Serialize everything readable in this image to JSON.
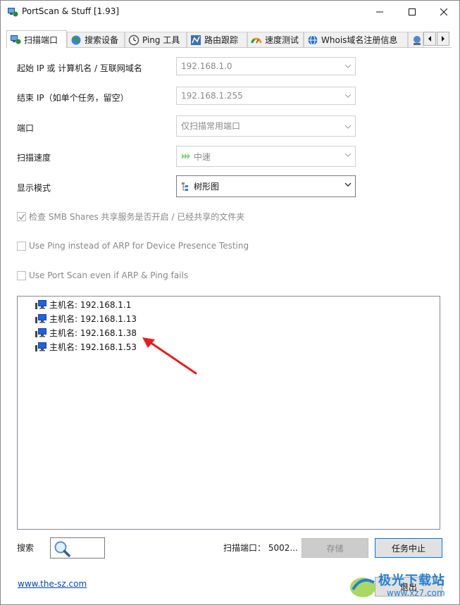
{
  "window": {
    "title": "PortScan & Stuff [1.93]"
  },
  "tabs": [
    {
      "label": "扫描端口",
      "icon": "scan-icon",
      "active": true
    },
    {
      "label": "搜索设备",
      "icon": "globe-icon",
      "active": false
    },
    {
      "label": "Ping 工具",
      "icon": "ping-clock-icon",
      "active": false
    },
    {
      "label": "路由跟踪",
      "icon": "route-icon",
      "active": false
    },
    {
      "label": "速度测试",
      "icon": "speedometer-icon",
      "active": false
    },
    {
      "label": "Whois域名注册信息",
      "icon": "whois-globe-icon",
      "active": false
    }
  ],
  "form": {
    "start_ip_label": "起始 IP 或 计算机名 / 互联网域名",
    "start_ip_value": "192.168.1.0",
    "end_ip_label": "结束 IP（如单个任务，留空）",
    "end_ip_value": "192.168.1.255",
    "port_label": "端口",
    "port_value": "仅扫描常用端口",
    "speed_label": "扫描速度",
    "speed_value": "中速",
    "display_label": "显示模式",
    "display_value": "树形图"
  },
  "checkboxes": {
    "smb": {
      "label": "检查 SMB Shares 共享服务是否开启 / 已经共享的文件夹",
      "checked": true
    },
    "ping": {
      "label": "Use Ping instead of ARP for Device Presence Testing",
      "checked": false
    },
    "portscan": {
      "label": "Use Port Scan even if ARP & Ping fails",
      "checked": false
    }
  },
  "results": [
    {
      "text": "主机名: 192.168.1.1"
    },
    {
      "text": "主机名: 192.168.1.13"
    },
    {
      "text": "主机名: 192.168.1.38"
    },
    {
      "text": "主机名: 192.168.1.53"
    }
  ],
  "footer": {
    "search_label": "搜索",
    "status_text": "扫描端口：  5002...",
    "save_label": "存储",
    "stop_label": "任务中止",
    "exit_label": "退出",
    "link_text": "www.the-sz.com"
  },
  "watermark": {
    "line1": "极光下载站",
    "line2": "www.xz7.com"
  },
  "colors": {
    "accent": "#0078d7",
    "annotation_arrow": "#e02020",
    "link": "#0645ad"
  }
}
